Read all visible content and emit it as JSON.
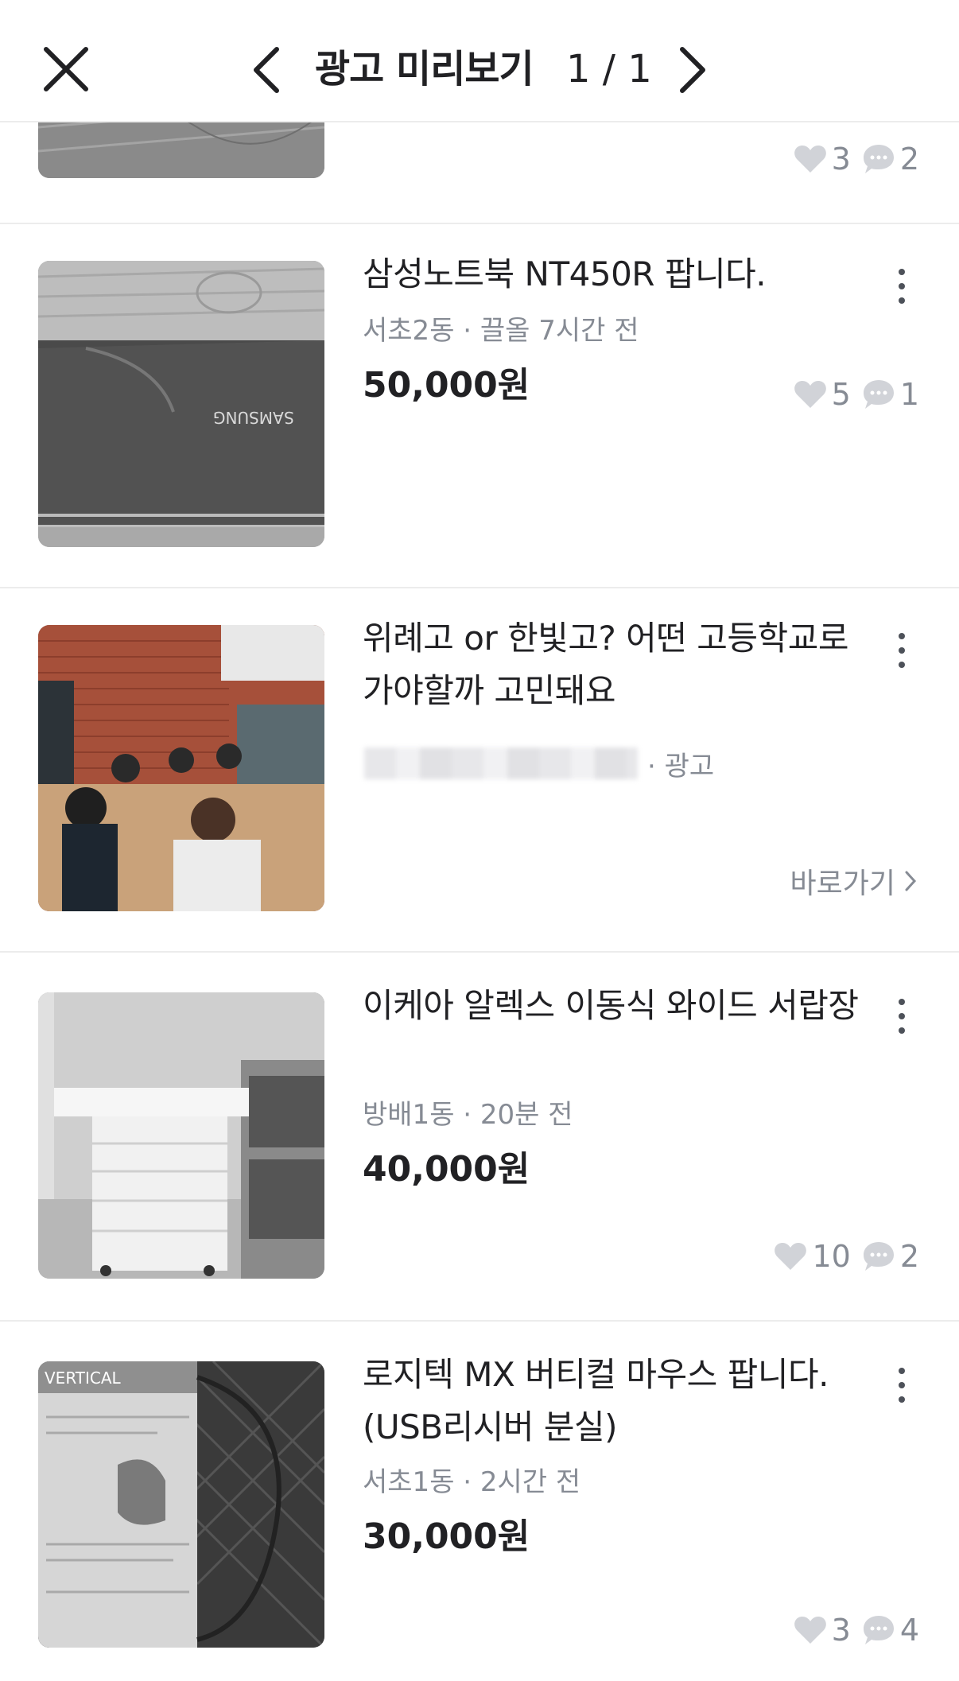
{
  "header": {
    "title": "광고 미리보기",
    "page_indicator": "1 / 1"
  },
  "items": [
    {
      "likes": "3",
      "comments": "2"
    },
    {
      "title": "삼성노트북 NT450R 팝니다.",
      "location_time": "서초2동 · 끌올 7시간 전",
      "price": "50,000원",
      "likes": "5",
      "comments": "1",
      "thumb_text": "SAMSUNG"
    },
    {
      "title": "위례고 or 한빛고? 어떤 고등학교로 가야할까 고민돼요",
      "ad_label": "· 광고",
      "goto_label": "바로가기"
    },
    {
      "title": "이케아 알렉스 이동식 와이드 서랍장",
      "location_time": "방배1동 · 20분 전",
      "price": "40,000원",
      "likes": "10",
      "comments": "2"
    },
    {
      "title": "로지텍 MX 버티컬 마우스 팝니다. (USB리시버 분실)",
      "location_time": "서초1동 · 2시간 전",
      "price": "30,000원",
      "likes": "3",
      "comments": "4",
      "thumb_text": "VERTICAL"
    }
  ],
  "icons": {
    "close": "close-icon",
    "prev": "chevron-left-icon",
    "next": "chevron-right-icon",
    "more": "more-vertical-icon",
    "like": "heart-icon",
    "comment": "chat-bubble-icon",
    "goto": "chevron-right-small-icon"
  }
}
